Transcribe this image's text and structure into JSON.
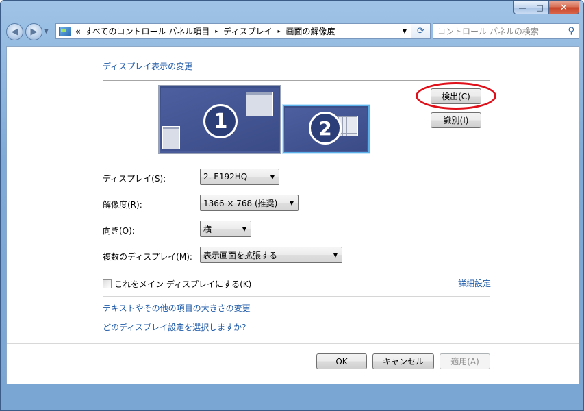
{
  "window": {
    "controls": {
      "minimize": "—",
      "maximize": "□",
      "close": "✕"
    }
  },
  "nav": {
    "back_icon": "back-arrow-icon",
    "forward_icon": "forward-arrow-icon",
    "address": {
      "prefix": "«",
      "crumbs": [
        "すべてのコントロール パネル項目",
        "ディスプレイ",
        "画面の解像度"
      ],
      "separator": "▸"
    },
    "search_placeholder": "コントロール パネルの検索"
  },
  "main": {
    "section_title": "ディスプレイ表示の変更",
    "monitors": [
      {
        "number": "1",
        "active": false
      },
      {
        "number": "2",
        "active": true
      }
    ],
    "detect_button": "検出(C)",
    "identify_button": "識別(I)",
    "fields": {
      "display": {
        "label": "ディスプレイ(S):",
        "value": "2. E192HQ"
      },
      "resolution": {
        "label": "解像度(R):",
        "value": "1366 × 768 (推奨)"
      },
      "orientation": {
        "label": "向き(O):",
        "value": "横"
      },
      "multiple": {
        "label": "複数のディスプレイ(M):",
        "value": "表示画面を拡張する"
      }
    },
    "main_display_checkbox": {
      "label": "これをメイン ディスプレイにする(K)",
      "checked": false
    },
    "advanced_link": "詳細設定",
    "links": [
      "テキストやその他の項目の大きさの変更",
      "どのディスプレイ設定を選択しますか?"
    ]
  },
  "footer": {
    "ok": "OK",
    "cancel": "キャンセル",
    "apply": "適用(A)"
  },
  "colors": {
    "link": "#1e5aa8",
    "highlight": "#e0101a",
    "monitor": "#3c4e88"
  }
}
